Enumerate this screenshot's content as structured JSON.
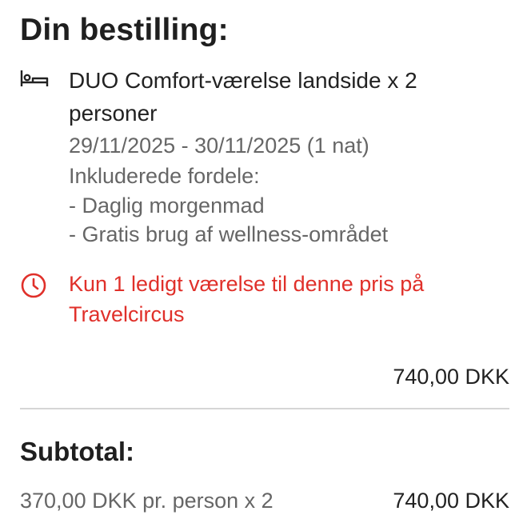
{
  "order": {
    "title": "Din bestilling:",
    "room": {
      "name": "DUO Comfort-værelse landside x 2 personer",
      "dates": "29/11/2025 - 30/11/2025 (1 nat)",
      "perks_title": "Inkluderede fordele:",
      "perks": [
        "- Daglig morgenmad",
        "- Gratis brug af wellness-området"
      ],
      "icon": "bed-icon",
      "price": "740,00 DKK"
    },
    "alert": {
      "icon": "clock-icon",
      "text": "Kun 1 ledigt værelse til denne pris på Travelcircus",
      "color": "#e0302a"
    }
  },
  "subtotal": {
    "label": "Subtotal:",
    "per_person": "370,00 DKK pr. person x 2",
    "price": "740,00 DKK"
  }
}
